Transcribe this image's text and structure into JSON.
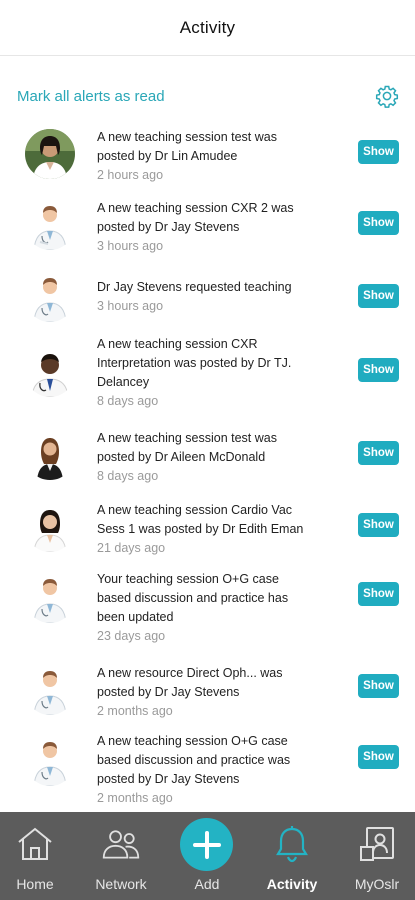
{
  "header": {
    "title": "Activity"
  },
  "actions": {
    "mark_all_label": "Mark all alerts as read",
    "settings_icon": "gear-icon"
  },
  "colors": {
    "accent": "#20acc0",
    "tabbar_bg": "#5c5c5c",
    "time_gray": "#9a9a9a"
  },
  "notifications": [
    {
      "message": "A new teaching session test was posted by Dr Lin Amudee",
      "time": "2 hours ago",
      "action": "Show",
      "avatar": "doctor-woman-photo"
    },
    {
      "message": "A new teaching session CXR 2 was posted by Dr Jay Stevens",
      "time": "3 hours ago",
      "action": "Show",
      "avatar": "doctor-man-illustration"
    },
    {
      "message": "Dr Jay Stevens requested teaching",
      "time": "3 hours ago",
      "action": "Show",
      "avatar": "doctor-man-illustration"
    },
    {
      "message": "A new teaching session CXR Interpretation was posted by Dr TJ. Delancey",
      "time": "8 days ago",
      "action": "Show",
      "avatar": "doctor-man-photo"
    },
    {
      "message": "A new teaching session test was posted by Dr Aileen McDonald",
      "time": "8 days ago",
      "action": "Show",
      "avatar": "businesswoman-photo"
    },
    {
      "message": "A new teaching session Cardio Vac Sess 1 was posted by Dr Edith Eman",
      "time": "21 days ago",
      "action": "Show",
      "avatar": "woman-doctor-photo"
    },
    {
      "message": "Your teaching session O+G case based discussion and practice has been updated",
      "time": "23 days ago",
      "action": "Show",
      "avatar": "doctor-man-illustration"
    },
    {
      "message": "A new resource Direct Oph... was posted by Dr Jay Stevens",
      "time": "2 months ago",
      "action": "Show",
      "avatar": "doctor-man-illustration"
    },
    {
      "message": "A new teaching session O+G case based discussion and practice was posted by Dr Jay Stevens",
      "time": "2 months ago",
      "action": "Show",
      "avatar": "doctor-man-illustration"
    }
  ],
  "tabbar": {
    "home": "Home",
    "network": "Network",
    "add": "Add",
    "activity": "Activity",
    "myoslr": "MyOslr",
    "active_tab": "Activity"
  }
}
